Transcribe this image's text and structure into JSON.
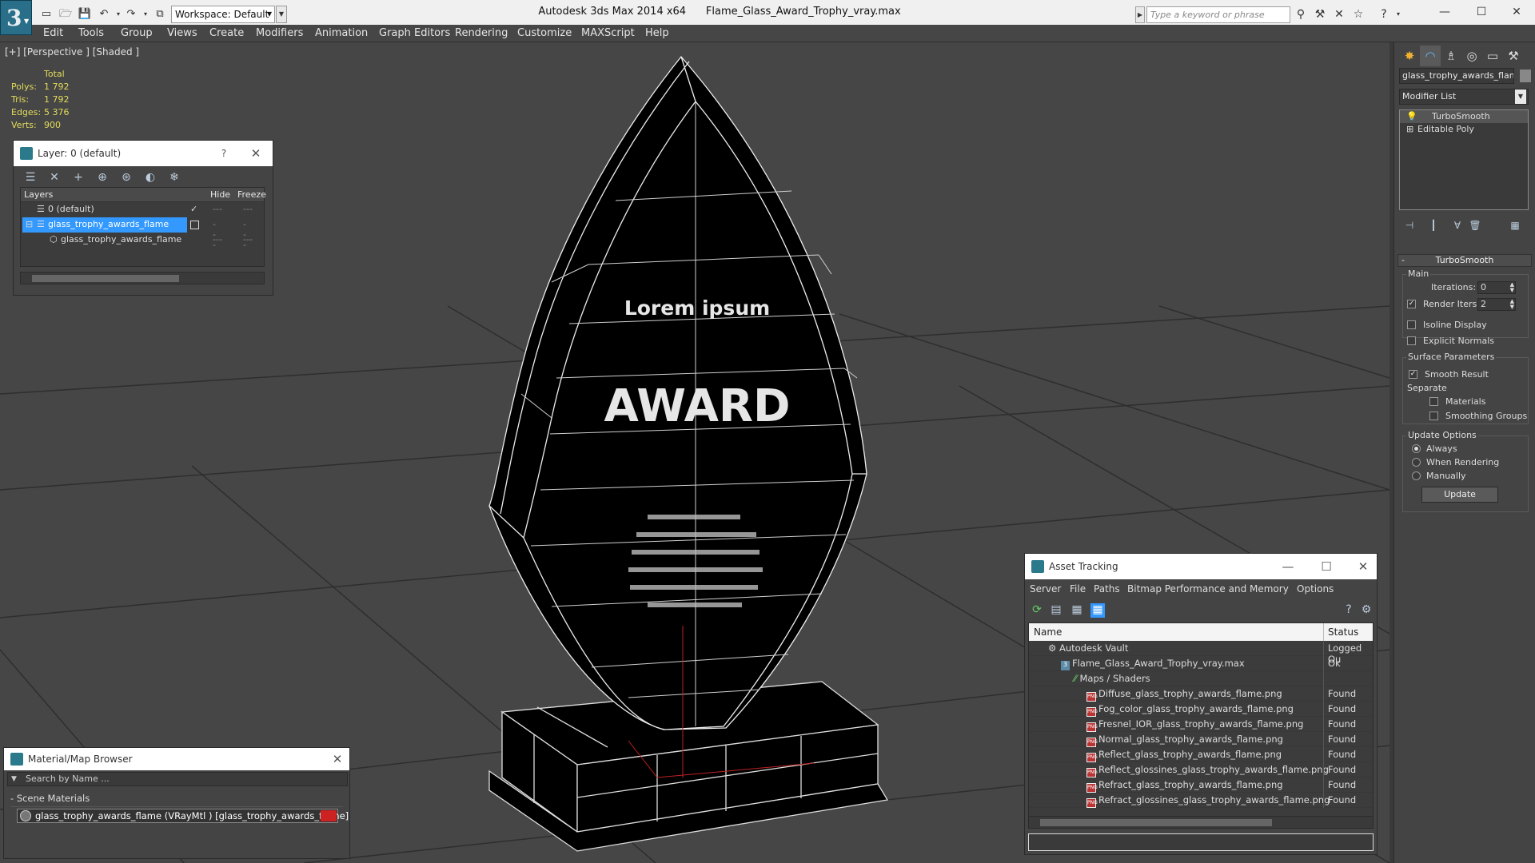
{
  "titlebar": {
    "workspace": "Workspace: Default",
    "app": "Autodesk 3ds Max  2014 x64",
    "file": "Flame_Glass_Award_Trophy_vray.max",
    "search_placeholder": "Type a keyword or phrase"
  },
  "menu": [
    "Edit",
    "Tools",
    "Group",
    "Views",
    "Create",
    "Modifiers",
    "Animation",
    "Graph Editors",
    "Rendering",
    "Customize",
    "MAXScript",
    "Help"
  ],
  "viewport": {
    "label": "[+] [Perspective ] [Shaded ]",
    "stats_header": "Total",
    "stats": [
      {
        "k": "Polys:",
        "v": "1 792"
      },
      {
        "k": "Tris:",
        "v": "1 792"
      },
      {
        "k": "Edges:",
        "v": "5 376"
      },
      {
        "k": "Verts:",
        "v": "900"
      }
    ],
    "trophy_text_top": "Lorem ipsum",
    "trophy_text_main": "AWARD"
  },
  "layer_panel": {
    "title": "Layer: 0 (default)",
    "help": "?",
    "col_layers": "Layers",
    "col_hide": "Hide",
    "col_freeze": "Freeze",
    "rows": [
      "0 (default)",
      "glass_trophy_awards_flame",
      "glass_trophy_awards_flame"
    ]
  },
  "asset_panel": {
    "title": "Asset Tracking",
    "menu": [
      "Server",
      "File",
      "Paths",
      "Bitmap Performance and Memory",
      "Options"
    ],
    "col_name": "Name",
    "col_status": "Status",
    "rows": [
      {
        "name": "Autodesk Vault",
        "status": "Logged Ou",
        "indent": 1
      },
      {
        "name": "Flame_Glass_Award_Trophy_vray.max",
        "status": "Ok",
        "indent": 2
      },
      {
        "name": "Maps / Shaders",
        "status": "",
        "indent": 3
      },
      {
        "name": "Diffuse_glass_trophy_awards_flame.png",
        "status": "Found",
        "indent": 4
      },
      {
        "name": "Fog_color_glass_trophy_awards_flame.png",
        "status": "Found",
        "indent": 4
      },
      {
        "name": "Fresnel_IOR_glass_trophy_awards_flame.png",
        "status": "Found",
        "indent": 4
      },
      {
        "name": "Normal_glass_trophy_awards_flame.png",
        "status": "Found",
        "indent": 4
      },
      {
        "name": "Reflect_glass_trophy_awards_flame.png",
        "status": "Found",
        "indent": 4
      },
      {
        "name": "Reflect_glossines_glass_trophy_awards_flame.png",
        "status": "Found",
        "indent": 4
      },
      {
        "name": "Refract_glass_trophy_awards_flame.png",
        "status": "Found",
        "indent": 4
      },
      {
        "name": "Refract_glossines_glass_trophy_awards_flame.png",
        "status": "Found",
        "indent": 4
      }
    ]
  },
  "material_browser": {
    "title": "Material/Map Browser",
    "search_placeholder": "Search by Name ...",
    "group": "Scene Materials",
    "item": "glass_trophy_awards_flame  (VRayMtl ) [glass_trophy_awards_flame]"
  },
  "command_panel": {
    "object_name": "glass_trophy_awards_flame",
    "modifier_list": "Modifier List",
    "stack": [
      "TurboSmooth",
      "Editable Poly"
    ],
    "rollout": "TurboSmooth",
    "main_label": "Main",
    "iterations_label": "Iterations:",
    "iterations": "0",
    "render_iters_label": "Render Iters:",
    "render_iters": "2",
    "isoline": "Isoline Display",
    "explicit": "Explicit Normals",
    "surface_label": "Surface Parameters",
    "smooth_result": "Smooth Result",
    "separate": "Separate",
    "materials": "Materials",
    "smoothing_groups": "Smoothing Groups",
    "update_label": "Update Options",
    "always": "Always",
    "when_rendering": "When Rendering",
    "manually": "Manually",
    "update_btn": "Update"
  },
  "colors": {
    "accent": "#3399ff",
    "material_swatch": "#cc2222",
    "stats": "#e2dc5c"
  }
}
